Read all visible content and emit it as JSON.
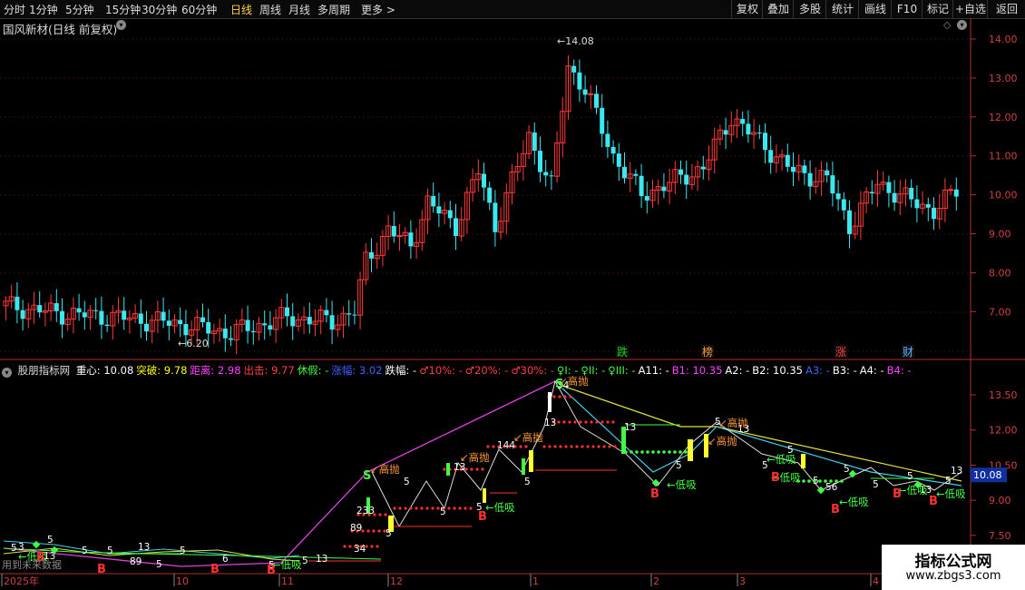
{
  "toolbar": {
    "periods": [
      "分时",
      "1分钟",
      "5分钟",
      "15分钟",
      "30分钟",
      "60分钟",
      "日线",
      "周线",
      "月线",
      "多周期",
      "更多"
    ],
    "active_period": "日线",
    "more_arrow": ">",
    "right_buttons": [
      "复权",
      "叠加",
      "多股",
      "统计",
      "画线",
      "F10",
      "标记",
      "+自选",
      "返回"
    ]
  },
  "stock": {
    "title": "国风新材(日线 前复权)",
    "dropdown_icon": "chevron-down-circle-icon",
    "diamond_icon": "diamond-icon"
  },
  "price_axis": {
    "ticks": [
      "14.00",
      "13.00",
      "12.00",
      "11.00",
      "10.00",
      "9.00",
      "8.00",
      "7.00"
    ]
  },
  "price_annotations": {
    "high": "14.08",
    "low": "6.20"
  },
  "event_markers": [
    {
      "label": "跌",
      "color": "#18d018"
    },
    {
      "label": "榜",
      "color": "#ff9a3c"
    },
    {
      "label": "涨",
      "color": "#ff3a3a"
    },
    {
      "label": "财",
      "color": "#5ab0ff"
    }
  ],
  "indicator": {
    "name": "股朋指标网",
    "fields": [
      {
        "label": "重心:",
        "value": "10.08",
        "color": "#ffffff"
      },
      {
        "label": "突破:",
        "value": "9.78",
        "color": "#ffff00"
      },
      {
        "label": "距离:",
        "value": "2.98",
        "color": "#ff40ff"
      },
      {
        "label": "出击:",
        "value": "9.77",
        "color": "#ff4040"
      },
      {
        "label": "休假:",
        "value": "-",
        "color": "#40ff40"
      },
      {
        "label": "涨幅:",
        "value": "3.02",
        "color": "#4060ff"
      },
      {
        "label": "跌幅:",
        "value": "-",
        "color": "#ffffff"
      },
      {
        "label": "♂10%:",
        "value": "-",
        "color": "#ff4040"
      },
      {
        "label": "♂20%:",
        "value": "-",
        "color": "#ff4040"
      },
      {
        "label": "♂30%:",
        "value": "-",
        "color": "#ff4040"
      },
      {
        "label": "♀I:",
        "value": "-",
        "color": "#40ff40"
      },
      {
        "label": "♀II:",
        "value": "-",
        "color": "#40ff40"
      },
      {
        "label": "♀III:",
        "value": "-",
        "color": "#40ff40"
      },
      {
        "label": "A11:",
        "value": "-",
        "color": "#ffffff"
      },
      {
        "label": "B1:",
        "value": "10.35",
        "color": "#ff40ff"
      },
      {
        "label": "A2:",
        "value": "-",
        "color": "#ffffff"
      },
      {
        "label": "B2:",
        "value": "10.35",
        "color": "#ffffff"
      },
      {
        "label": "A3:",
        "value": "-",
        "color": "#4060ff"
      },
      {
        "label": "B3:",
        "value": "-",
        "color": "#ffffff"
      },
      {
        "label": "A4:",
        "value": "-",
        "color": "#ffffff"
      },
      {
        "label": "B4:",
        "value": "-",
        "color": "#ff40ff"
      }
    ],
    "axis_ticks": [
      "13.50",
      "12.00",
      "10.50",
      "9.00",
      "7.50"
    ],
    "current_value": "10.08",
    "labels": {
      "high_throw": "高抛",
      "low_buy": "低吸",
      "buy": "B",
      "sell": "S"
    }
  },
  "time_axis": {
    "labels": [
      "2025年",
      "10",
      "11",
      "12",
      "1",
      "2",
      "3",
      "4"
    ],
    "footer_note": "用到未来数据"
  },
  "watermark": {
    "title": "指标公式网",
    "url": "www.zbgs3.com"
  },
  "colors": {
    "up": "#ff3a3a",
    "down": "#3ae8f0",
    "axis": "#b03030",
    "bg": "#000000"
  }
}
